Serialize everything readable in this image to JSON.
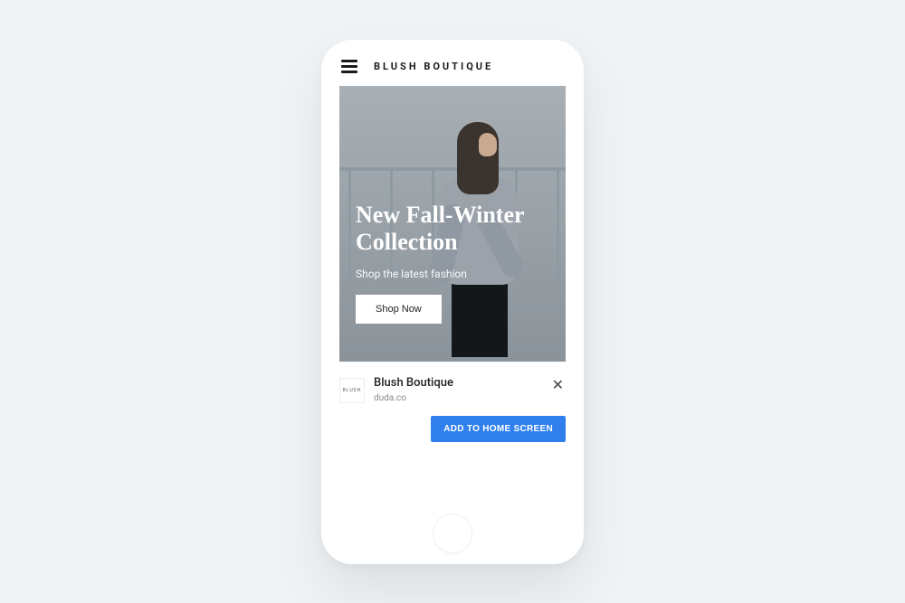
{
  "header": {
    "brand": "BLUSH BOUTIQUE"
  },
  "hero": {
    "title": "New Fall-Winter Collection",
    "subtitle": "Shop the latest fashion",
    "cta": "Shop Now"
  },
  "install_prompt": {
    "icon_text": "BLUSH",
    "title": "Blush Boutique",
    "domain": "duda.co",
    "action": "ADD TO HOME SCREEN"
  }
}
